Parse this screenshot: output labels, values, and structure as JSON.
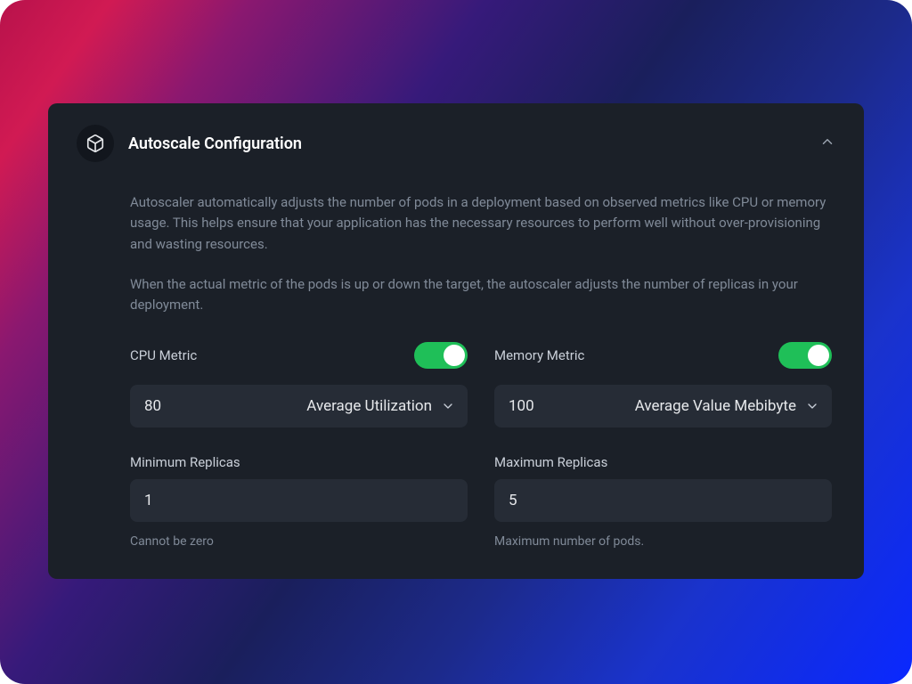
{
  "panel": {
    "title": "Autoscale Configuration",
    "desc1": "Autoscaler automatically adjusts the number of pods in a deployment based on observed metrics like CPU or memory usage. This helps ensure that your application has the necessary resources to perform well without over-provisioning and wasting resources.",
    "desc2": "When the actual metric of the pods is up or down the target, the autoscaler adjusts the number of replicas in your deployment."
  },
  "cpu": {
    "label": "CPU Metric",
    "enabled": true,
    "value": "80",
    "mode": "Average Utilization"
  },
  "memory": {
    "label": "Memory Metric",
    "enabled": true,
    "value": "100",
    "mode": "Average Value Mebibyte"
  },
  "min_replicas": {
    "label": "Minimum Replicas",
    "value": "1",
    "help": "Cannot be zero"
  },
  "max_replicas": {
    "label": "Maximum Replicas",
    "value": "5",
    "help": "Maximum number of pods."
  }
}
